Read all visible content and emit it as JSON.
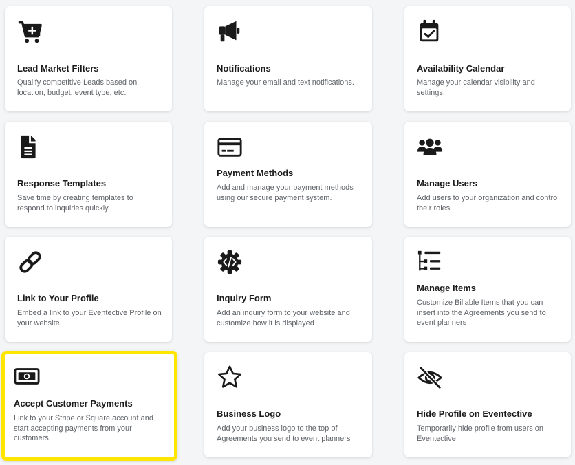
{
  "cards": [
    {
      "id": "lead-market-filters",
      "icon": "shopping-cart-plus-icon",
      "title": "Lead Market Filters",
      "description": "Qualify competitive Leads based on location, budget, event type, etc."
    },
    {
      "id": "notifications",
      "icon": "megaphone-icon",
      "title": "Notifications",
      "description": "Manage your email and text notifications."
    },
    {
      "id": "availability-calendar",
      "icon": "calendar-check-icon",
      "title": "Availability Calendar",
      "description": "Manage your calendar visibility and settings."
    },
    {
      "id": "response-templates",
      "icon": "document-icon",
      "title": "Response Templates",
      "description": "Save time by creating templates to respond to inquiries quickly."
    },
    {
      "id": "payment-methods",
      "icon": "credit-card-icon",
      "title": "Payment Methods",
      "description": "Add and manage your payment methods using our secure payment system."
    },
    {
      "id": "manage-users",
      "icon": "users-icon",
      "title": "Manage Users",
      "description": "Add users to your organization and control their roles"
    },
    {
      "id": "link-to-your-profile",
      "icon": "link-icon",
      "title": "Link to Your Profile",
      "description": "Embed a link to your Eventective Profile on your website."
    },
    {
      "id": "inquiry-form",
      "icon": "code-gear-icon",
      "title": "Inquiry Form",
      "description": "Add an inquiry form to your website and customize how it is displayed"
    },
    {
      "id": "manage-items",
      "icon": "list-tree-icon",
      "title": "Manage Items",
      "description": "Customize Billable Items that you can insert into the Agreements you send to event planners"
    },
    {
      "id": "accept-customer-payments",
      "icon": "money-bill-icon",
      "title": "Accept Customer Payments",
      "description": "Link to your Stripe or Square account and start accepting payments from your customers"
    },
    {
      "id": "business-logo",
      "icon": "star-icon",
      "title": "Business Logo",
      "description": "Add your business logo to the top of Agreements you send to event planners"
    },
    {
      "id": "hide-profile-on-eventective",
      "icon": "eye-slash-icon",
      "title": "Hide Profile on Eventective",
      "description": "Temporarily hide profile from users on Eventective"
    }
  ],
  "colors": {
    "highlight": "#ffe600",
    "icon": "#1a1a1a",
    "card_bg": "#ffffff",
    "page_bg": "#f4f5f7"
  }
}
